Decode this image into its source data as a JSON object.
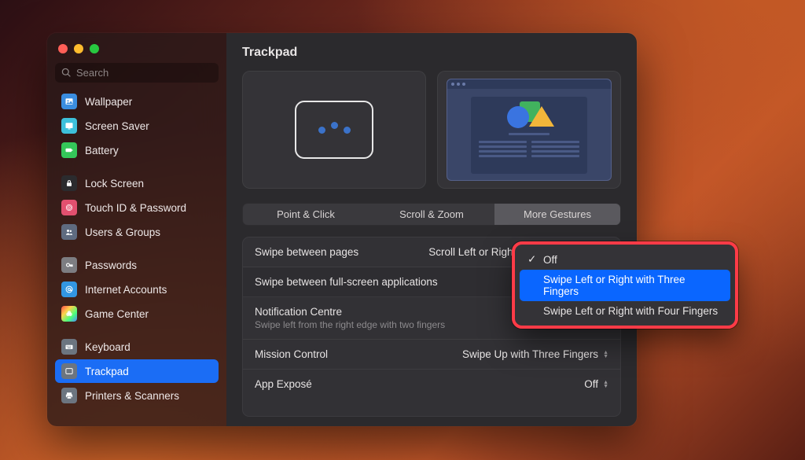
{
  "window": {
    "title": "Trackpad"
  },
  "search": {
    "placeholder": "Search"
  },
  "sidebar": {
    "items": [
      {
        "label": "Wallpaper",
        "icon": "wallpaper",
        "cls": "si-blue"
      },
      {
        "label": "Screen Saver",
        "icon": "screensaver",
        "cls": "si-teal"
      },
      {
        "label": "Battery",
        "icon": "battery",
        "cls": "si-green"
      },
      {
        "label": "Lock Screen",
        "icon": "lock",
        "cls": "si-dark",
        "gapBefore": true
      },
      {
        "label": "Touch ID & Password",
        "icon": "touchid",
        "cls": "si-pink"
      },
      {
        "label": "Users & Groups",
        "icon": "users",
        "cls": "si-slate"
      },
      {
        "label": "Passwords",
        "icon": "key",
        "cls": "si-grey",
        "gapBefore": true
      },
      {
        "label": "Internet Accounts",
        "icon": "at",
        "cls": "si-sky"
      },
      {
        "label": "Game Center",
        "icon": "gamecenter",
        "cls": "si-multi"
      },
      {
        "label": "Keyboard",
        "icon": "keyboard",
        "cls": "si-steel",
        "gapBefore": true
      },
      {
        "label": "Trackpad",
        "icon": "trackpad",
        "cls": "si-steel",
        "selected": true
      },
      {
        "label": "Printers & Scanners",
        "icon": "printer",
        "cls": "si-steel"
      }
    ]
  },
  "tabs": {
    "items": [
      {
        "label": "Point & Click"
      },
      {
        "label": "Scroll & Zoom"
      },
      {
        "label": "More Gestures",
        "active": true
      }
    ]
  },
  "settings": {
    "rows": [
      {
        "label": "Swipe between pages",
        "value": "Scroll Left or Right with Two Fingers"
      },
      {
        "label": "Swipe between full-screen applications",
        "value": ""
      },
      {
        "label": "Notification Centre",
        "sub": "Swipe left from the right edge with two fingers"
      },
      {
        "label": "Mission Control",
        "value": "Swipe Up with Three Fingers"
      },
      {
        "label": "App Exposé",
        "value": "Off"
      }
    ]
  },
  "dropdown": {
    "items": [
      {
        "label": "Off",
        "checked": true
      },
      {
        "label": "Swipe Left or Right with Three Fingers",
        "selected": true
      },
      {
        "label": "Swipe Left or Right with Four Fingers"
      }
    ]
  }
}
